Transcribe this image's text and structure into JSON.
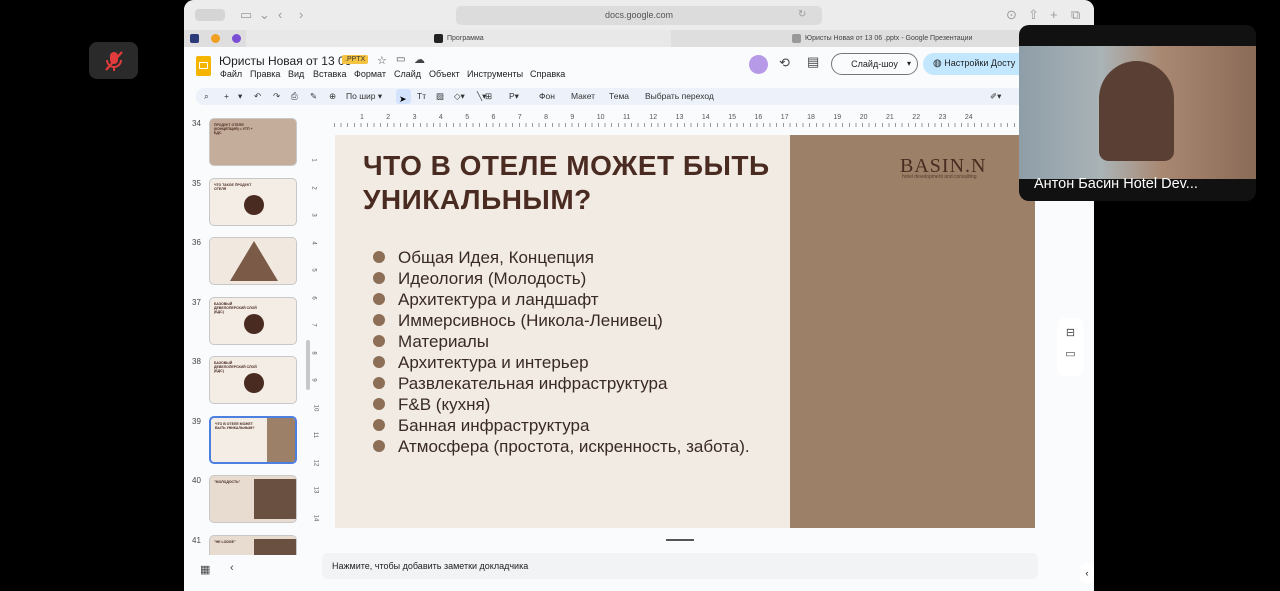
{
  "browser": {
    "url": "docs.google.com",
    "tabs": [
      {
        "label": "Программа"
      },
      {
        "label": "Юристы Новая от 13 06 .pptx - Google Презентации"
      }
    ]
  },
  "doc": {
    "title": "Юристы Новая от 13 06",
    "badge": ".PPTX",
    "menu": [
      "Файл",
      "Правка",
      "Вид",
      "Вставка",
      "Формат",
      "Слайд",
      "Объект",
      "Инструменты",
      "Справка"
    ],
    "slideshow_label": "Слайд-шоу",
    "access_label": "Настройки Досту"
  },
  "toolbar": {
    "zoom_label": "По шир",
    "background_label": "Фон",
    "layout_label": "Макет",
    "theme_label": "Тема",
    "transition_label": "Выбрать переход"
  },
  "ruler": {
    "numbers": [
      "1",
      "2",
      "3",
      "4",
      "5",
      "6",
      "7",
      "8",
      "9",
      "10",
      "11",
      "12",
      "13",
      "14",
      "15",
      "16",
      "17",
      "18",
      "19",
      "20",
      "21",
      "22",
      "23",
      "24"
    ],
    "vnumbers": [
      "1",
      "2",
      "3",
      "4",
      "5",
      "6",
      "7",
      "8",
      "9",
      "10",
      "11",
      "12",
      "13",
      "14"
    ]
  },
  "filmstrip": [
    {
      "num": "34",
      "title": "ПРОДУКТ ОТЕЛЯ (КОНЦЕПЦИЯ) = УТП + БДС"
    },
    {
      "num": "35",
      "title": "ЧТО ТАКОЕ ПРОДУКТ ОТЕЛЯ"
    },
    {
      "num": "36",
      "title": ""
    },
    {
      "num": "37",
      "title": "БАЗОВЫЙ ДЕВЕЛОПЕРСКИЙ СЛОЙ (БДС)"
    },
    {
      "num": "38",
      "title": "БАЗОВЫЙ ДЕВЕЛОПЕРСКИЙ СЛОЙ (БДС)"
    },
    {
      "num": "39",
      "title": "ЧТО В ОТЕЛЕ МОЖЕТ БЫТЬ УНИКАЛЬНЫМ?"
    },
    {
      "num": "40",
      "title": "\"МОЛОДОСТЬ\""
    },
    {
      "num": "41",
      "title": "\"HE LODGE\""
    }
  ],
  "slide": {
    "title": "ЧТО В ОТЕЛЕ МОЖЕТ БЫТЬ УНИКАЛЬНЫМ?",
    "logo": "BASIN.N",
    "logo_sub": "hotel development and consulting",
    "bullets": [
      "Общая Идея, Концепция",
      "Идеология (Молодость)",
      "Архитектура и ландшафт",
      "Иммерсивноcь (Никола-Ленивец)",
      "Материалы",
      "Архитектура и интерьер",
      "Развлекательная инфраструктура",
      "F&B (кухня)",
      "Банная инфраструктура",
      "Атмосфера (простота, искренность, забота)."
    ]
  },
  "notes": {
    "placeholder": "Нажмите, чтобы добавить заметки докладчика"
  },
  "video": {
    "name": "Антон Басин Hotel Dev..."
  },
  "colors": {
    "accent": "#4c7fe0",
    "slide_brown": "#9c8067",
    "title_brown": "#4a2b22"
  }
}
